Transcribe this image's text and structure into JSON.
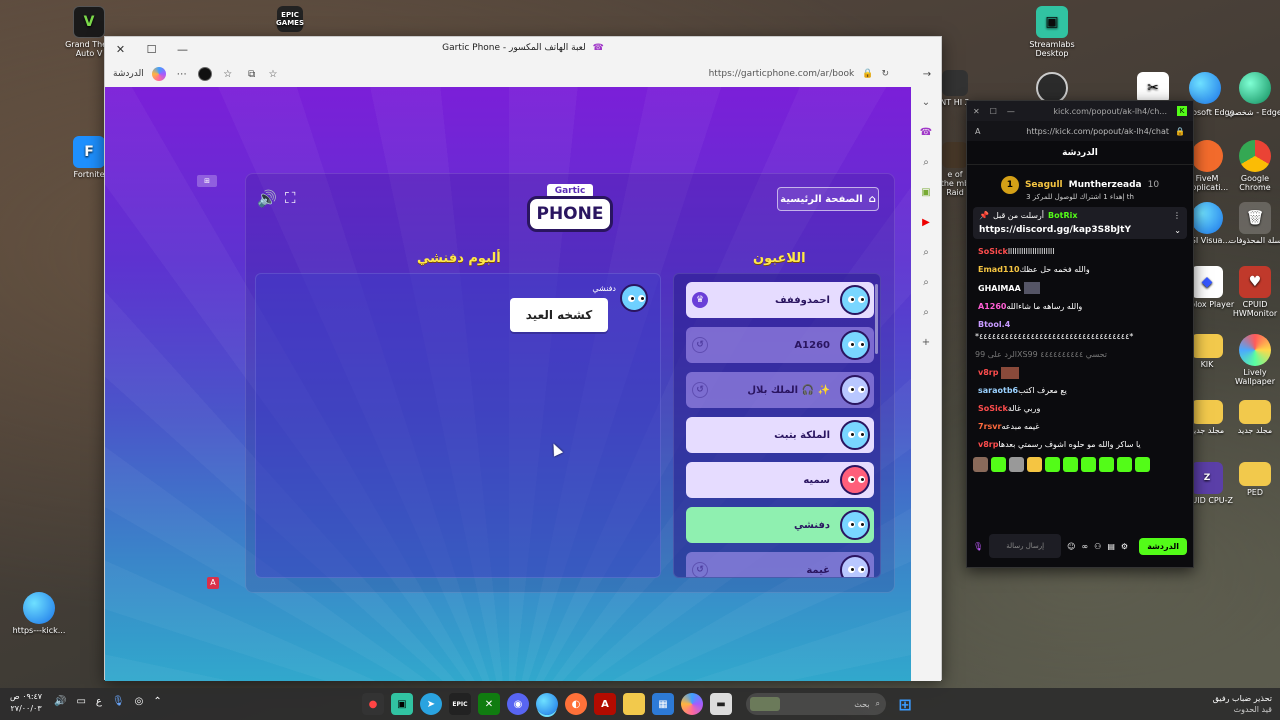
{
  "desktop": {
    "icons_left": [
      {
        "label": "Grand Theft Auto V",
        "glyph": "V"
      },
      {
        "label": "Fortnite",
        "glyph": "F"
      },
      {
        "label": "https---kick...",
        "glyph": ""
      }
    ],
    "epic_label": "EPIC GAMES",
    "icons_right": [
      {
        "label": "Streamlabs Desktop"
      },
      {
        "label": "Microsoft Edge"
      },
      {
        "label": "شخصي - Edge"
      },
      {
        "label": "FiveM Applicati..."
      },
      {
        "label": "Google Chrome"
      },
      {
        "label": "MSI Visua..."
      },
      {
        "label": "سلة المحذوفات"
      },
      {
        "label": "Roblox Player"
      },
      {
        "label": "CPUID HWMonitor"
      },
      {
        "label": "KIK"
      },
      {
        "label": "Lively Wallpaper"
      },
      {
        "label": "مجلد جديد"
      },
      {
        "label": "مجلد جديد"
      },
      {
        "label": "CPUID CPU-Z"
      },
      {
        "label": "PED"
      }
    ],
    "partial_labels": [
      "NT HI 2",
      "e of the mb Raid"
    ]
  },
  "browser": {
    "title": "Gartic Phone - لعبة الهاتف المكسور",
    "url": "https://garticphone.com/ar/book",
    "chat_label": "الدردشة"
  },
  "game": {
    "home_button": "الصفحة الرئيسية",
    "logo_top": "Gartic",
    "logo_main": "PHONE",
    "album_title": "ألبوم دفنشي",
    "players_title": "اللاعبون",
    "album_author": "دفنشي",
    "album_text": "كشخه العيد",
    "players": [
      {
        "name": "احمدوففف",
        "state": "done",
        "lead": "crown"
      },
      {
        "name": "A1260",
        "state": "wait",
        "lead": "ghost"
      },
      {
        "name": "الملك بلال 🎧 ✨",
        "state": "wait",
        "lead": "ghost"
      },
      {
        "name": "الملكة بتبت",
        "state": "done",
        "lead": ""
      },
      {
        "name": "سميه",
        "state": "done",
        "lead": ""
      },
      {
        "name": "دفنشي",
        "state": "active",
        "lead": ""
      },
      {
        "name": "غيمة",
        "state": "wait",
        "lead": "ghost"
      }
    ],
    "overlay_badge": "A"
  },
  "kick": {
    "url": "https://kick.com/popout/ak-lh4/chat",
    "title_url": "kick.com/popout/ak-lh4/ch...",
    "header": "الدردشة",
    "gift": {
      "rank": "1",
      "user": "Seagull",
      "sub_user": "Muntherzeada",
      "count": "10",
      "note": "إهداء 1 اشتراك للوصول للمركز 3 ⁦th"
    },
    "pinned": {
      "by": "أرسلت من قبل",
      "user": "BotRix",
      "link": "https://discord.gg/kap3S8bJtY"
    },
    "messages": [
      {
        "user": "SoSick",
        "text": "ااااااااااااااااااااا",
        "color": "#ff4d4d"
      },
      {
        "user": "Emad110",
        "text": "والله فخمه حل عظك",
        "color": "#f5c542"
      },
      {
        "user": "GHAIMAA",
        "text": "",
        "color": "#ffffff"
      },
      {
        "user": "A1260",
        "text": "والله رساهه ما شاءالله",
        "color": "#ff5fd4"
      },
      {
        "user": "Btool.4",
        "text": "*٤٤٤٤٤٤٤٤٤٤٤٤٤٤٤٤٤٤٤٤٤٤٤٤٤٤٤٤٤٤٤٤٤٤٤*",
        "color": "#c89bff"
      },
      {
        "user": "99XS99",
        "text": "الرد على 99XS99 تحسي ٤٤٤٤٤٤٤٤٤٤",
        "color": "#777777"
      },
      {
        "user": "v8rp",
        "text": "",
        "color": "#ff4d4d"
      },
      {
        "user": "saraotb6",
        "text": "يع معرف اكتب",
        "color": "#9ad1ff"
      },
      {
        "user": "SoSick",
        "text": "وربي غالة",
        "color": "#ff4d4d"
      },
      {
        "user": "7rsvr",
        "text": "غيمه مبدعه",
        "color": "#ff6a3d"
      },
      {
        "user": "v8rp",
        "text": "يا ساكر والله مو حلوه اشوف رسمتي بعدها",
        "color": "#ff4d4d"
      }
    ],
    "input_placeholder": "إرسال رسالة",
    "send_label": "الدردشة"
  },
  "taskbar": {
    "time": "٠٩:٤٧ ص",
    "date": "٢٧/٠٠/٠٣",
    "lang": "ع",
    "search_placeholder": "بحث",
    "weather": "تحذير ضباب رفيق",
    "weather_sub": "قيد الحدوث"
  }
}
